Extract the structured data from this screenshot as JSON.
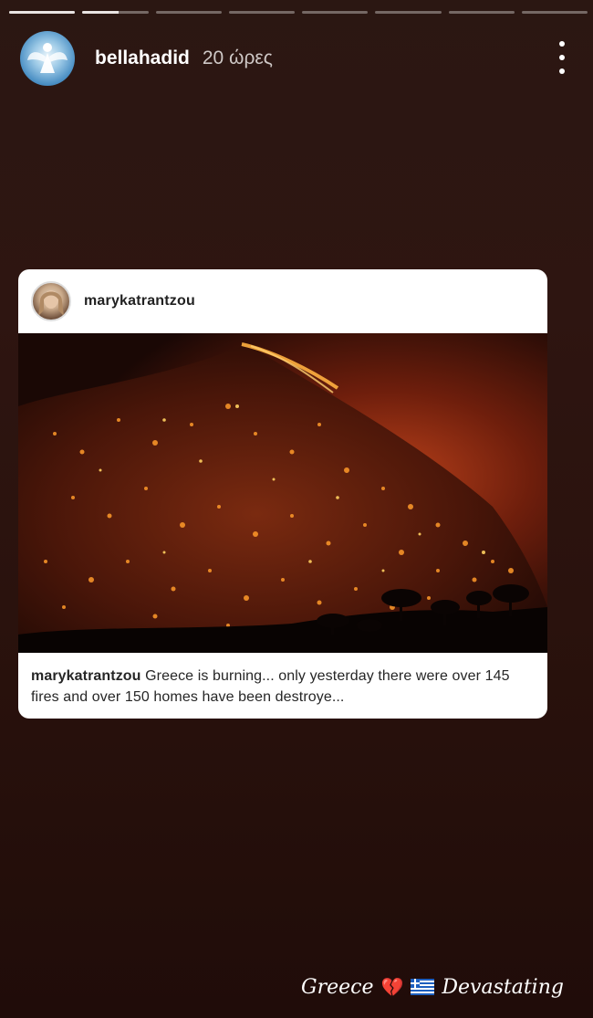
{
  "story": {
    "username": "bellahadid",
    "time": "20 ώρες",
    "progress_segments": [
      1.0,
      0.55,
      0,
      0,
      0,
      0,
      0,
      0
    ]
  },
  "shared_post": {
    "username": "marykatrantzou",
    "caption_username": "marykatrantzou",
    "caption_text": "Greece is burning... only yesterday there were over 145 fires and over 150 homes have been destroye..."
  },
  "sticker_text": {
    "word1": "Greece",
    "word2": "Devastating",
    "emoji": "💔"
  }
}
